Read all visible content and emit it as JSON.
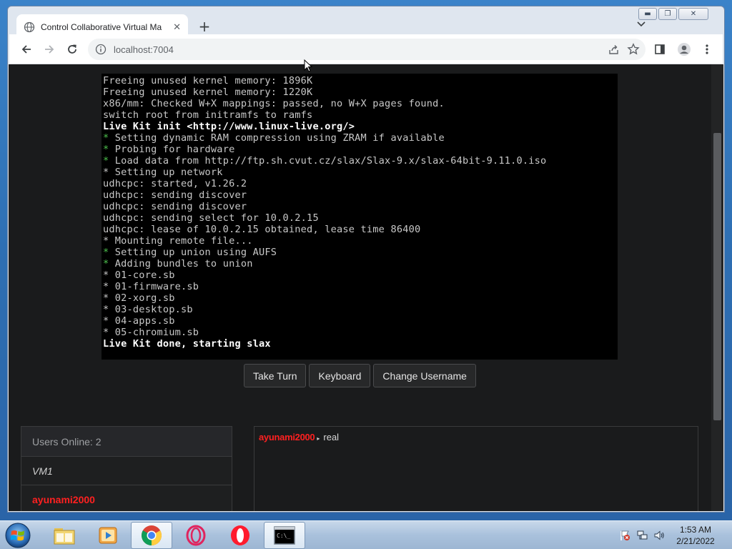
{
  "browser": {
    "tab_title": "Control Collaborative Virtual Ma",
    "new_tab_symbol": "+",
    "url": "localhost:7004"
  },
  "terminal": {
    "lines": [
      {
        "text": "Freeing unused kernel memory: 1896K",
        "style": "normal"
      },
      {
        "text": "Freeing unused kernel memory: 1220K",
        "style": "normal"
      },
      {
        "text": "x86/mm: Checked W+X mappings: passed, no W+X pages found.",
        "style": "normal"
      },
      {
        "text": "switch root from initramfs to ramfs",
        "style": "normal"
      },
      {
        "text": "Live Kit init <http://www.linux-live.org/>",
        "style": "bright"
      },
      {
        "text": "* Setting dynamic RAM compression using ZRAM if available",
        "style": "green-star"
      },
      {
        "text": "* Probing for hardware",
        "style": "green-star"
      },
      {
        "text": "* Load data from http://ftp.sh.cvut.cz/slax/Slax-9.x/slax-64bit-9.11.0.iso",
        "style": "green-star"
      },
      {
        "text": "* Setting up network",
        "style": "normal"
      },
      {
        "text": "udhcpc: started, v1.26.2",
        "style": "normal"
      },
      {
        "text": "udhcpc: sending discover",
        "style": "normal"
      },
      {
        "text": "udhcpc: sending discover",
        "style": "normal"
      },
      {
        "text": "udhcpc: sending select for 10.0.2.15",
        "style": "normal"
      },
      {
        "text": "udhcpc: lease of 10.0.2.15 obtained, lease time 86400",
        "style": "normal"
      },
      {
        "text": "* Mounting remote file...",
        "style": "normal"
      },
      {
        "text": "* Setting up union using AUFS",
        "style": "green-star"
      },
      {
        "text": "* Adding bundles to union",
        "style": "green-star"
      },
      {
        "text": "* 01-core.sb",
        "style": "normal"
      },
      {
        "text": "* 01-firmware.sb",
        "style": "normal"
      },
      {
        "text": "* 02-xorg.sb",
        "style": "normal"
      },
      {
        "text": "* 03-desktop.sb",
        "style": "normal"
      },
      {
        "text": "* 04-apps.sb",
        "style": "normal"
      },
      {
        "text": "* 05-chromium.sb",
        "style": "normal"
      },
      {
        "text": "Live Kit done, starting slax",
        "style": "bright"
      }
    ],
    "cursor": "_"
  },
  "controls": {
    "take_turn": "Take Turn",
    "keyboard": "Keyboard",
    "change_username": "Change Username"
  },
  "users": {
    "header": "Users Online: 2",
    "list": [
      {
        "name": "VM1",
        "kind": "vm"
      },
      {
        "name": "ayunami2000",
        "kind": "me"
      }
    ]
  },
  "chat": {
    "messages": [
      {
        "user": "ayunami2000",
        "arrow": "▸",
        "text": "real"
      }
    ]
  },
  "taskbar": {
    "time": "1:53 AM",
    "date": "2/21/2022"
  },
  "colors": {
    "username_red": "#ff2020",
    "star_green": "#4ec24e",
    "page_bg": "#1a1b1c"
  }
}
